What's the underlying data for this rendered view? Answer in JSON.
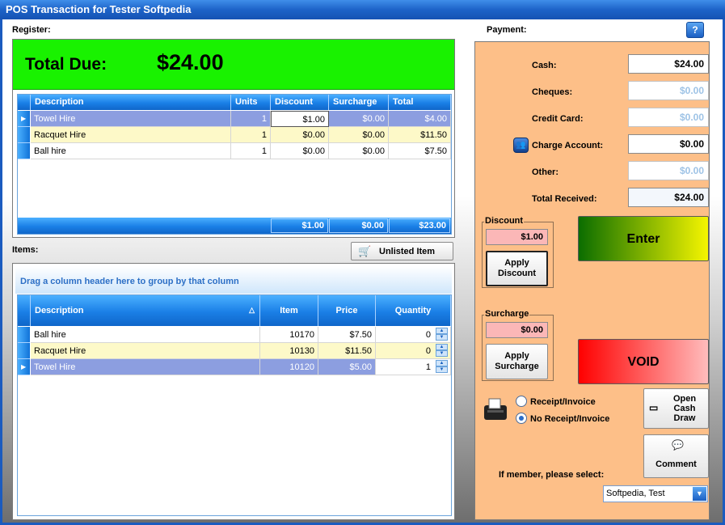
{
  "window": {
    "title": "POS Transaction for Tester Softpedia"
  },
  "register": {
    "label": "Register:",
    "total_due_label": "Total Due:",
    "total_due_value": "$24.00",
    "columns": [
      "Description",
      "Units",
      "Discount",
      "Surcharge",
      "Total"
    ],
    "rows": [
      {
        "description": "Towel Hire",
        "units": "1",
        "discount": "$1.00",
        "surcharge": "$0.00",
        "total": "$4.00"
      },
      {
        "description": "Racquet Hire",
        "units": "1",
        "discount": "$0.00",
        "surcharge": "$0.00",
        "total": "$11.50"
      },
      {
        "description": "Ball hire",
        "units": "1",
        "discount": "$0.00",
        "surcharge": "$0.00",
        "total": "$7.50"
      }
    ],
    "totals": {
      "discount": "$1.00",
      "surcharge": "$0.00",
      "total": "$23.00"
    }
  },
  "items": {
    "label": "Items:",
    "unlisted_button": "Unlisted Item",
    "group_hint": "Drag a column header here to group by that column",
    "columns": [
      "Description",
      "Item",
      "Price",
      "Quantity"
    ],
    "rows": [
      {
        "description": "Ball hire",
        "item": "10170",
        "price": "$7.50",
        "quantity": "0"
      },
      {
        "description": "Racquet Hire",
        "item": "10130",
        "price": "$11.50",
        "quantity": "0"
      },
      {
        "description": "Towel Hire",
        "item": "10120",
        "price": "$5.00",
        "quantity": "1"
      }
    ]
  },
  "payment": {
    "label": "Payment:",
    "cash_label": "Cash:",
    "cash_value": "$24.00",
    "cheques_label": "Cheques:",
    "cheques_value": "$0.00",
    "credit_label": "Credit Card:",
    "credit_value": "$0.00",
    "charge_label": "Charge Account:",
    "charge_value": "$0.00",
    "other_label": "Other:",
    "other_value": "$0.00",
    "received_label": "Total Received:",
    "received_value": "$24.00",
    "discount_title": "Discount",
    "discount_value": "$1.00",
    "apply_discount": "Apply Discount",
    "surcharge_title": "Surcharge",
    "surcharge_value": "$0.00",
    "apply_surcharge": "Apply Surcharge",
    "enter_button": "Enter",
    "void_button": "VOID",
    "receipt_option": "Receipt/Invoice",
    "no_receipt_option": "No Receipt/Invoice",
    "open_cash_draw": "Open Cash Draw",
    "comment_button": "Comment",
    "member_label": "If member, please select:",
    "member_value": "Softpedia, Test"
  },
  "colors": {
    "total_due_bg": "#19f200",
    "payment_bg": "#fdbf88",
    "grid_header": "#1a7fe6",
    "selected_row": "#8c9ee0",
    "alt_row": "#fdf9c8"
  }
}
